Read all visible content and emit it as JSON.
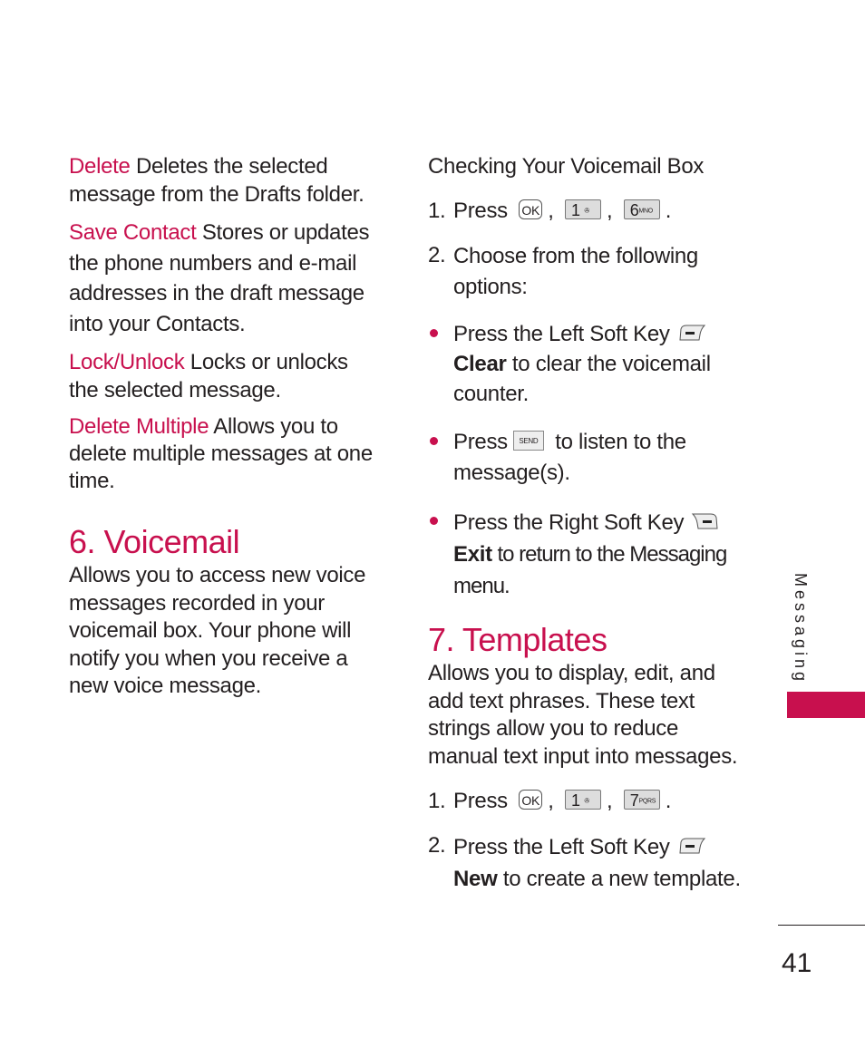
{
  "left_column": {
    "entries": [
      {
        "term": "Delete",
        "text": " Deletes the selected message from the Drafts folder."
      },
      {
        "term": "Save Contact",
        "text": " Stores or updates the phone numbers and e-mail addresses in the draft message into your Contacts."
      },
      {
        "term": "Lock/Unlock",
        "text": " Locks or unlocks the selected message."
      },
      {
        "term": "Delete Multiple",
        "text": "  Allows you to delete multiple messages at one time."
      }
    ],
    "section6": {
      "title": "6. Voicemail",
      "body": "Allows you to access new voice messages recorded in your voicemail box. Your phone will notify you when you receive a new voice message."
    }
  },
  "right_column": {
    "subheading": "Checking Your Voicemail Box",
    "step1": {
      "num": "1.",
      "label": "Press",
      "keys": [
        "OK",
        "1",
        "6"
      ],
      "key_sub": [
        "",
        "✇",
        "MNO"
      ]
    },
    "step2": {
      "num": "2.",
      "text": "Choose from the following options:"
    },
    "bullets": [
      {
        "pre": "Press the Left Soft Key",
        "bold": "Clear",
        "post": " to clear the voicemail counter."
      },
      {
        "pre": "Press",
        "key": "SEND",
        "post": " to listen to the message(s)."
      },
      {
        "pre": "Press the Right Soft Key",
        "bold": "Exit",
        "post": " to return to the Messaging menu."
      }
    ],
    "section7": {
      "title": "7. Templates",
      "body": "Allows you to display, edit, and add text phrases. These text strings allow you to reduce manual text input into messages.",
      "step1": {
        "num": "1.",
        "label": "Press",
        "keys": [
          "OK",
          "1",
          "7"
        ],
        "key_sub": [
          "",
          "✇",
          "PQRS"
        ]
      },
      "step2": {
        "num": "2.",
        "pre": "Press the Left Soft Key",
        "bold": "New",
        "post": " to create a new template."
      }
    }
  },
  "sidebar": {
    "label": "Messaging",
    "accent": "#c8104e"
  },
  "page_number": "41"
}
